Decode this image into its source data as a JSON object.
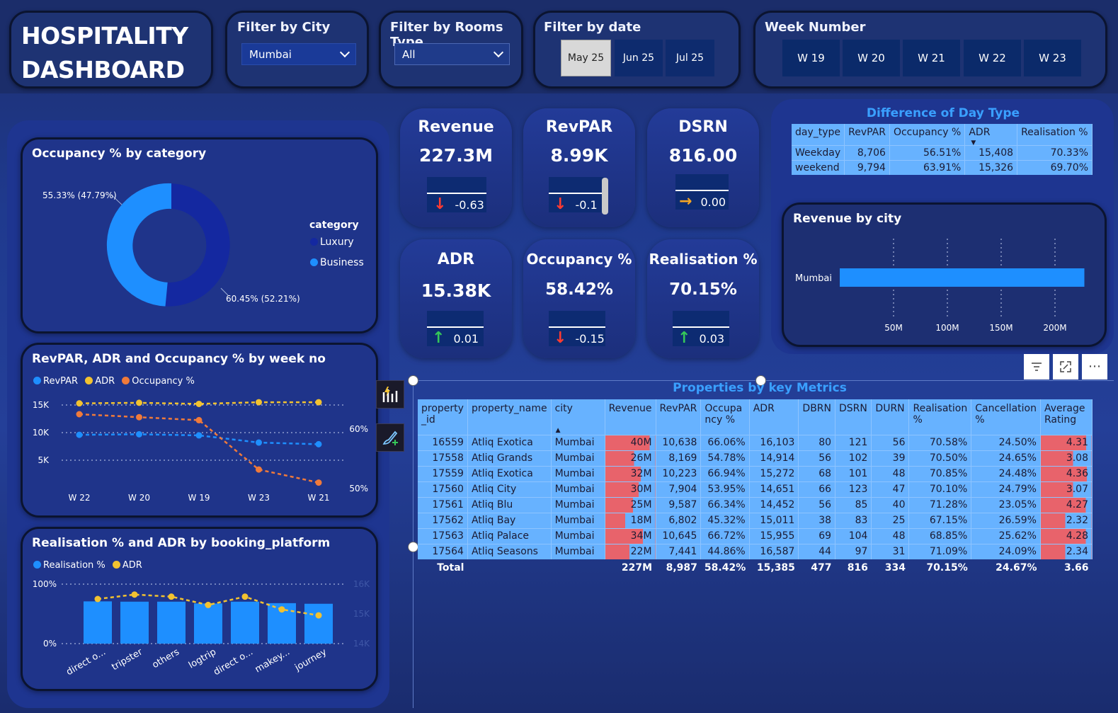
{
  "header": {
    "title_line1": "HOSPITALITY",
    "title_line2": "DASHBOARD",
    "city_filter": {
      "label": "Filter by City",
      "value": "Mumbai"
    },
    "room_filter": {
      "label": "Filter by Rooms Type",
      "value": "All"
    },
    "date_filter": {
      "label": "Filter by date",
      "options": [
        "May 25",
        "Jun 25",
        "Jul 25"
      ],
      "selected": "May 25"
    },
    "week_filter": {
      "label": "Week Number",
      "options": [
        "W 19",
        "W 20",
        "W 21",
        "W 22",
        "W 23"
      ]
    }
  },
  "kpis": [
    {
      "title": "Revenue",
      "value": "227.3M",
      "delta": "-0.63",
      "direction": "down"
    },
    {
      "title": "RevPAR",
      "value": "8.99K",
      "delta": "-0.1",
      "direction": "down"
    },
    {
      "title": "DSRN",
      "value": "816.00",
      "delta": "0.00",
      "direction": "flat"
    },
    {
      "title": "ADR",
      "value": "15.38K",
      "delta": "0.01",
      "direction": "up"
    },
    {
      "title": "Occupancy %",
      "value": "58.42%",
      "delta": "-0.15",
      "direction": "down"
    },
    {
      "title": "Realisation %",
      "value": "70.15%",
      "delta": "0.03",
      "direction": "up"
    }
  ],
  "colors": {
    "down": "#ff3b30",
    "up": "#35c759",
    "flat": "#f5a623",
    "blue": "#1e8fff",
    "dark_blue": "#1428a0",
    "yellow": "#f2c230",
    "orange": "#f07a3a",
    "bar_red": "#e8636b"
  },
  "day_type_table": {
    "title": "Difference of Day Type",
    "columns": [
      "day_type",
      "RevPAR",
      "Occupancy %",
      "ADR",
      "Realisation %"
    ],
    "rows": [
      [
        "Weekday",
        "8,706",
        "56.51%",
        "15,408",
        "70.33%"
      ],
      [
        "weekend",
        "9,794",
        "63.91%",
        "15,326",
        "69.70%"
      ]
    ]
  },
  "occupancy_donut": {
    "title": "Occupancy % by category",
    "legend_title": "category",
    "label_business": "55.33% (47.79%)",
    "label_luxury": "60.45% (52.21%)"
  },
  "revenue_city": {
    "title": "Revenue by city"
  },
  "trend_chart": {
    "title": "RevPAR, ADR and Occupancy % by week no"
  },
  "platform_chart": {
    "title": "Realisation % and ADR by booking_platform"
  },
  "chart_data": [
    {
      "type": "pie",
      "title": "Occupancy % by category",
      "categories": [
        "Luxury",
        "Business"
      ],
      "values": [
        52.21,
        47.79
      ],
      "labels": [
        "60.45% (52.21%)",
        "55.33% (47.79%)"
      ],
      "legend_title": "category",
      "legend_position": "right"
    },
    {
      "type": "bar",
      "title": "Revenue by city",
      "orientation": "horizontal",
      "categories": [
        "Mumbai"
      ],
      "values": [
        227.3
      ],
      "xticks": [
        "50M",
        "100M",
        "150M",
        "200M"
      ],
      "xlim": [
        0,
        230
      ]
    },
    {
      "type": "line",
      "title": "RevPAR, ADR and Occupancy % by week no",
      "categories": [
        "W 22",
        "W 20",
        "W 19",
        "W 23",
        "W 21"
      ],
      "series": [
        {
          "name": "RevPAR",
          "axis": "left",
          "values": [
            9600,
            9700,
            9500,
            8200,
            7900
          ]
        },
        {
          "name": "ADR",
          "axis": "left",
          "values": [
            15300,
            15400,
            15200,
            15500,
            15500
          ]
        },
        {
          "name": "Occupancy %",
          "axis": "right",
          "values": [
            62.5,
            62.0,
            61.5,
            53.2,
            51.0
          ]
        }
      ],
      "yticks_left": [
        "15K",
        "10K",
        "5K"
      ],
      "yticks_right": [
        "60%",
        "50%"
      ],
      "ylim_left": [
        0,
        17000
      ],
      "ylim_right": [
        45,
        66
      ],
      "legend_position": "top-left"
    },
    {
      "type": "bar",
      "title": "Realisation % and ADR by booking_platform",
      "categories": [
        "direct o...",
        "tripster",
        "others",
        "logtrip",
        "direct o...",
        "makey...",
        "journey"
      ],
      "series": [
        {
          "name": "Realisation %",
          "axis": "left",
          "values": [
            71,
            70.5,
            70.5,
            67.5,
            70.5,
            68,
            67
          ]
        },
        {
          "name": "ADR",
          "axis": "right",
          "type": "line",
          "values": [
            15500,
            15650,
            15580,
            15300,
            15580,
            15150,
            14950
          ]
        }
      ],
      "yticks_left": [
        "100%",
        "0%"
      ],
      "yticks_right": [
        "16K",
        "15K",
        "14K"
      ],
      "ylim_left": [
        0,
        100
      ],
      "ylim_right": [
        14000,
        16000
      ],
      "legend_position": "top-left"
    }
  ],
  "properties": {
    "title": "Properties by key Metrics",
    "columns": [
      "property\n_id",
      "property_name",
      "city",
      "Revenue",
      "RevPAR",
      "Occupa\nncy %",
      "ADR",
      "DBRN",
      "DSRN",
      "DURN",
      "Realisation\n%",
      "Cancellation\n%",
      "Average\nRating"
    ],
    "rows": [
      [
        "16559",
        "Atliq Exotica",
        "Mumbai",
        "40M",
        "10,638",
        "66.06%",
        "16,103",
        "80",
        "121",
        "56",
        "70.58%",
        "24.50%",
        "4.31"
      ],
      [
        "17558",
        "Atliq Grands",
        "Mumbai",
        "26M",
        "8,169",
        "54.78%",
        "14,914",
        "56",
        "102",
        "39",
        "70.50%",
        "24.65%",
        "3.08"
      ],
      [
        "17559",
        "Atliq Exotica",
        "Mumbai",
        "32M",
        "10,223",
        "66.94%",
        "15,272",
        "68",
        "101",
        "48",
        "70.85%",
        "24.48%",
        "4.36"
      ],
      [
        "17560",
        "Atliq City",
        "Mumbai",
        "30M",
        "7,904",
        "53.95%",
        "14,651",
        "66",
        "123",
        "47",
        "70.10%",
        "24.79%",
        "3.07"
      ],
      [
        "17561",
        "Atliq Blu",
        "Mumbai",
        "25M",
        "9,587",
        "66.34%",
        "14,452",
        "56",
        "85",
        "40",
        "71.28%",
        "23.05%",
        "4.27"
      ],
      [
        "17562",
        "Atliq Bay",
        "Mumbai",
        "18M",
        "6,802",
        "45.32%",
        "15,011",
        "38",
        "83",
        "25",
        "67.15%",
        "26.59%",
        "2.32"
      ],
      [
        "17563",
        "Atliq Palace",
        "Mumbai",
        "34M",
        "10,645",
        "66.72%",
        "15,955",
        "69",
        "104",
        "48",
        "68.85%",
        "25.62%",
        "4.28"
      ],
      [
        "17564",
        "Atliq Seasons",
        "Mumbai",
        "22M",
        "7,441",
        "44.86%",
        "16,587",
        "44",
        "97",
        "31",
        "71.09%",
        "24.09%",
        "2.34"
      ]
    ],
    "revenue_values": [
      40,
      26,
      32,
      30,
      25,
      18,
      34,
      22
    ],
    "rating_values": [
      4.31,
      3.08,
      4.36,
      3.07,
      4.27,
      2.32,
      4.28,
      2.34
    ],
    "total": [
      "Total",
      "",
      "",
      "227M",
      "8,987",
      "58.42%",
      "15,385",
      "477",
      "816",
      "334",
      "70.15%",
      "24.67%",
      "3.66"
    ]
  },
  "icons": {
    "filter": "filter-icon",
    "focus": "focus-mode-icon",
    "more": "more-options-icon",
    "visualize": "build-visual-icon",
    "format": "format-paint-icon"
  }
}
